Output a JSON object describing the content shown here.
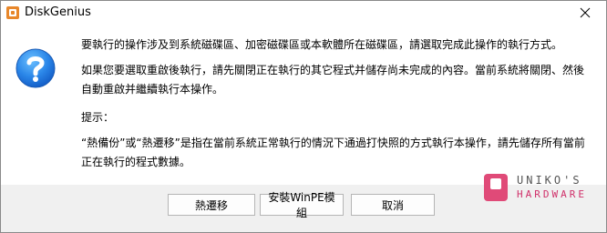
{
  "window": {
    "title": "DiskGenius",
    "close_icon": "close-icon",
    "app_icon": "diskgenius-app-icon"
  },
  "dialog": {
    "icon": "question-icon",
    "messages": [
      "要執行的操作涉及到系統磁碟區、加密磁碟區或本軟體所在磁碟區，請選取完成此操作的執行方式。",
      "如果您要選取重啟後執行，請先關閉正在執行的其它程式并儲存尚未完成的內容。當前系統將關閉、然後自動重啟并繼續執行本操作。",
      "提示：",
      "“熱備份”或“熱遷移”是指在當前系統正常執行的情況下通過打快照的方式執行本操作，請先儲存所有當前正在執行的程式數據。"
    ]
  },
  "buttons": {
    "hot_migrate": "熱遷移",
    "install_winpe": "安裝WinPE模組",
    "cancel": "取消"
  },
  "watermark": {
    "line1": "UNIKO'S",
    "line2": "HARDWARE"
  },
  "colors": {
    "question_icon_gradient_top": "#4aa6f5",
    "question_icon_gradient_bottom": "#1560c9",
    "app_icon": "#e8872a",
    "watermark_pink": "#d0306a"
  }
}
